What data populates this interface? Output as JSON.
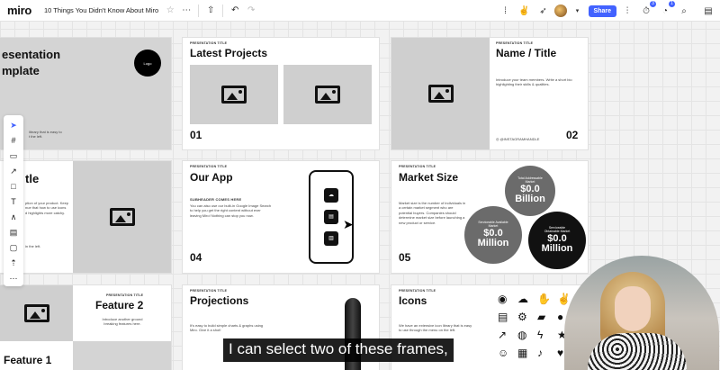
{
  "app": {
    "logo": "miro",
    "board_title": "10 Things You Didn't Know About Miro",
    "share_label": "Share",
    "notification_count_a": "3",
    "notification_count_b": "1"
  },
  "toolbar_tools": [
    "select",
    "frame",
    "sticky-note",
    "connector",
    "shape",
    "text",
    "pen",
    "table",
    "comment",
    "upload",
    "more"
  ],
  "frames": {
    "template": {
      "title_line1": "esentation",
      "title_line2": "mplate",
      "logo_text": "Logo",
      "body": "library that is easy to\nt the left."
    },
    "latest": {
      "title": "Latest Projects",
      "num1": "01",
      "label": "PRESENTATION TITLE"
    },
    "name_title": {
      "label": "PRESENTATION TITLE",
      "title": "Name / Title",
      "body": "Introduce your team members. Write a short bio highlighting their skills & qualities.",
      "handle": "@INSTAGRAMHANDLE",
      "num": "02"
    },
    "tle": {
      "title": "tle",
      "body": "ption of your product. Keep\nnue that how to use icons\nd highlights more catchy.",
      "note": "in the left."
    },
    "our_app": {
      "label": "PRESENTATION TITLE",
      "title": "Our App",
      "subheader": "SUBHEADER COMES HERE",
      "body": "You can also use our built-in Google Image Search to help you get the right content without ever leaving Miro! Nothing can stop you now.",
      "num": "04"
    },
    "market": {
      "label": "PRESENTATION TITLE",
      "title": "Market Size",
      "body": "Market size is the number of individuals in a certain market segment who are potential buyers. Companies should determine market size before launching a new product or service.",
      "num": "05",
      "circles": [
        {
          "label": "Total Addressable Market",
          "value_line1": "$0.0",
          "value_line2": "Billion"
        },
        {
          "label": "Serviceable Available Market",
          "value_line1": "$0.0",
          "value_line2": "Million"
        },
        {
          "label": "Serviceable Obtainable Market",
          "value_line1": "$0.0",
          "value_line2": "Million"
        }
      ]
    },
    "feature2": {
      "label": "PRESENTATION TITLE",
      "title": "Feature 2",
      "body": "Introduce another ground breaking features here."
    },
    "feature1": {
      "title": "Feature 1"
    },
    "projections": {
      "label": "PRESENTATION TITLE",
      "title": "Projections",
      "body": "It's easy to build simple charts & graphs using Miro. Give it a shot!"
    },
    "icons": {
      "label": "PRESENTATION TITLE",
      "title": "Icons",
      "body": "We have an extensive icon library that is easy to use through the menu on the left."
    }
  },
  "subtitle": "I can select two of these frames,",
  "colors": {
    "accent": "#4262ff",
    "placeholder": "#cfcfcf",
    "circle_light": "#6b6b6b",
    "circle_dark": "#111111"
  }
}
